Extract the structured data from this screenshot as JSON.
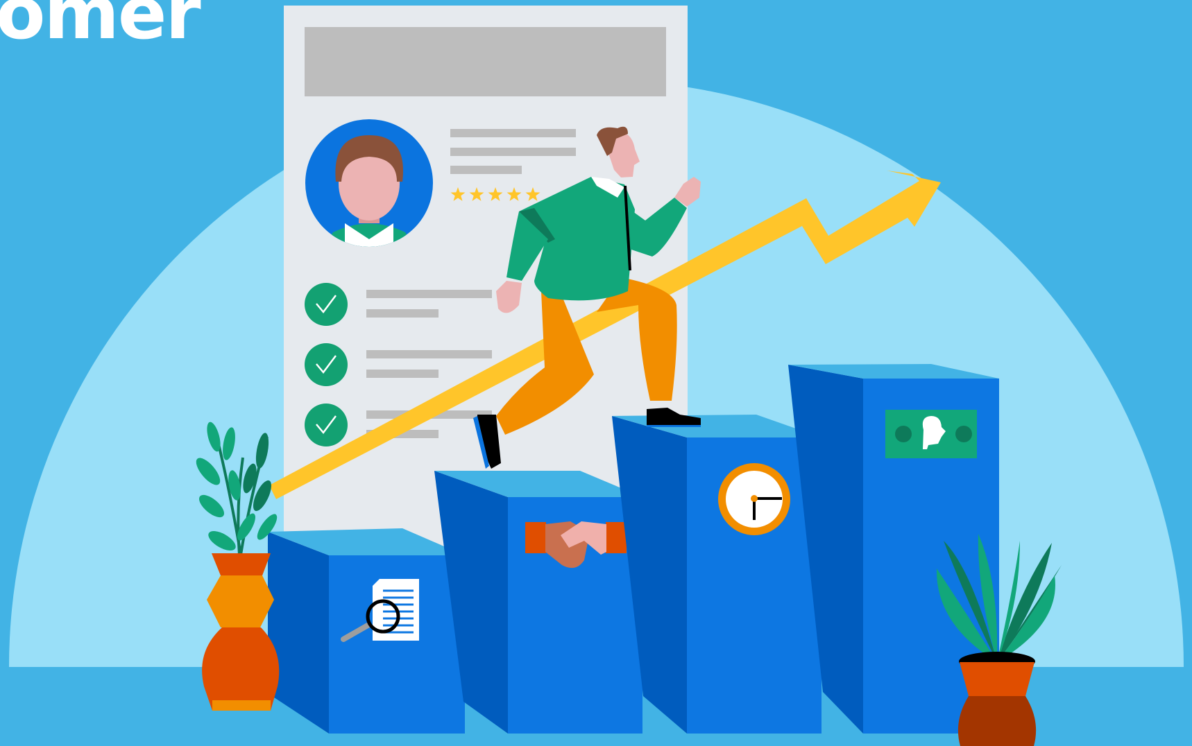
{
  "headline": {
    "text": "omer"
  },
  "profile_card": {
    "rating": {
      "stars": 5
    },
    "checklist": {
      "checked_items": 3
    }
  },
  "growth_steps": [
    {
      "icon": "document-magnifier-icon"
    },
    {
      "icon": "handshake-icon"
    },
    {
      "icon": "clock-icon"
    },
    {
      "icon": "banknote-icon"
    }
  ],
  "colors": {
    "background": "#42b3e5",
    "arc": "#99dff8",
    "step_front": "#0d77e2",
    "step_side": "#005cbe",
    "step_top": "#42b3e5",
    "arrow": "#ffc52a",
    "shirt": "#12a77a",
    "pants": "#f28e00",
    "check": "#13a172"
  }
}
